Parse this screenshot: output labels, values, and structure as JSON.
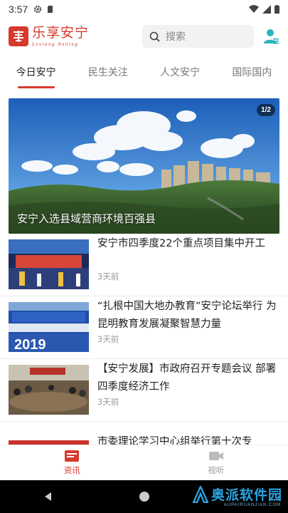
{
  "status_bar": {
    "time": "3:57"
  },
  "header": {
    "logo_cn": "乐享安宁",
    "logo_en": "Lexiang Anning",
    "search_placeholder": "搜索"
  },
  "tabs": [
    {
      "label": "今日安宁",
      "active": true
    },
    {
      "label": "民生关注",
      "active": false
    },
    {
      "label": "人文安宁",
      "active": false
    },
    {
      "label": "国际国内",
      "active": false
    }
  ],
  "banner": {
    "title": "安宁入选县域营商环境百强县",
    "counter": "1/2"
  },
  "news": [
    {
      "title": "安宁市四季度22个重点项目集中开工",
      "time": "3天前"
    },
    {
      "title": "“扎根中国大地办教育”安宁论坛举行 为昆明教育发展凝聚智慧力量",
      "time": "3天前"
    },
    {
      "title": "【安宁发展】市政府召开专题会议 部署四季度经济工作",
      "time": "3天前"
    },
    {
      "title": "市委理论学习中心组举行第十次专题“under",
      "time": ""
    }
  ],
  "bottom_nav": [
    {
      "label": "资讯",
      "icon": "news-icon",
      "active": true
    },
    {
      "label": "视听",
      "icon": "video-icon",
      "active": false
    }
  ],
  "watermark": {
    "text": "奥派软件园",
    "url": "AUPAIRUANJIAN.COM"
  },
  "colors": {
    "accent": "#d63a2d",
    "watermark": "#2ba3e0"
  }
}
